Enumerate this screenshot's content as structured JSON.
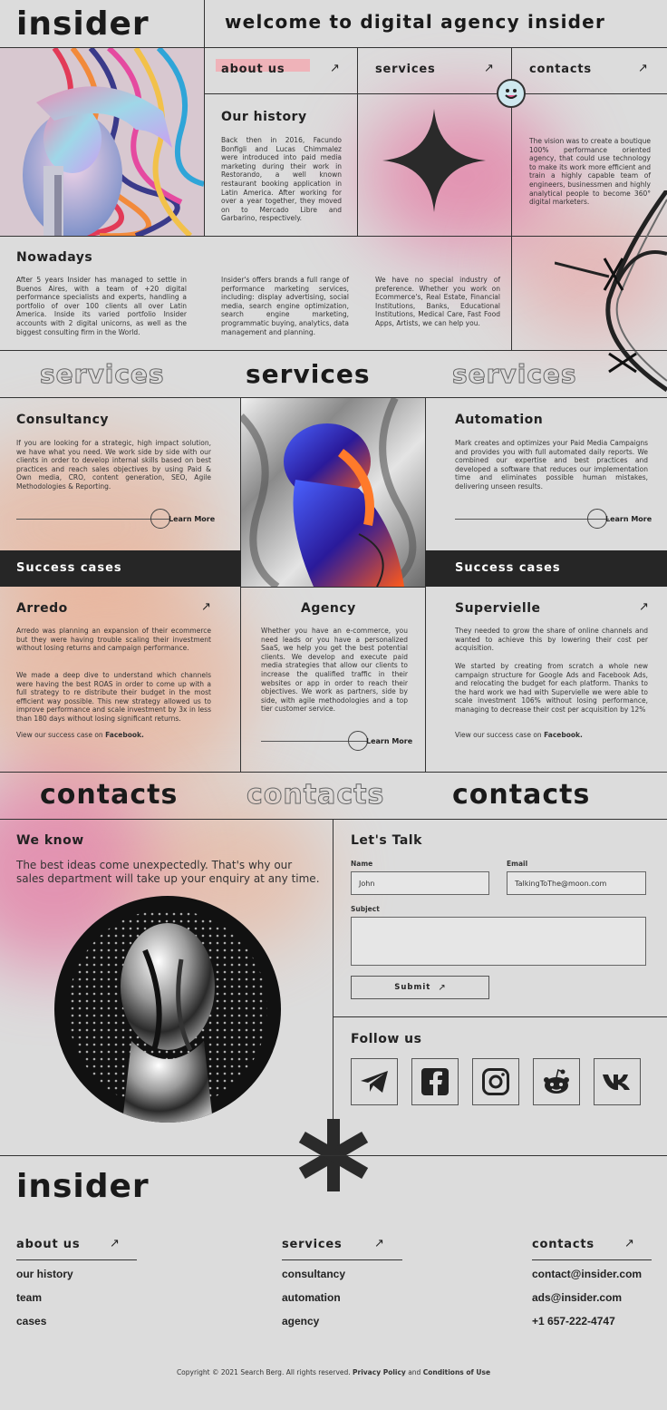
{
  "header": {
    "logo": "insider",
    "welcome": "welcome to digital agency insider"
  },
  "nav": {
    "about": "about us",
    "services": "services",
    "contacts": "contacts",
    "arrow": "↗"
  },
  "history": {
    "title": "Our history",
    "text": "Back then in 2016, Facundo Bonfigli and Lucas Chimmalez were introduced into paid media marketing during their work in Restorando, a well known restaurant booking application in Latin America. After working for over a year together, they moved on to Mercado Libre and Garbarino, respectively."
  },
  "vision": {
    "text": "The vision was to create a boutique 100% performance oriented agency, that could use technology to make its work more efficient and train a highly capable team of engineers, businessmen and highly analytical people to become 360° digital marketers."
  },
  "nowadays": {
    "title": "Nowadays",
    "col1": "After 5 years Insider has managed to settle in Buenos Aires, with a team of +20 digital performance specialists and experts, handling a portfolio of over 100 clients all over Latin America. Inside its varied portfolio Insider accounts with 2 digital unicorns, as well as the biggest consulting firm in the World.",
    "col2": "Insider's offers brands a full range of performance marketing services, including: display advertising, social media, search engine optimization, search engine marketing, programmatic buying, analytics, data management and planning.",
    "col3": "We have no special industry of preference. Whether you work on Ecommerce's, Real Estate, Financial Institutions, Banks, Educational Institutions, Medical Care, Fast Food Apps, Artists, we can help you."
  },
  "services_band": {
    "left": "services",
    "center": "services",
    "right": "services"
  },
  "consultancy": {
    "title": "Consultancy",
    "text": "If you are looking for a strategic, high impact solution, we have what you need. We work side by side with our clients in order to develop internal skills based on best practices and reach sales objectives by using Paid & Own media, CRO, content generation, SEO, Agile Methodologies & Reporting.",
    "learn": "Learn More"
  },
  "automation": {
    "title": "Automation",
    "text": "Mark creates and optimizes your Paid Media Campaigns and provides you with full automated daily reports. We combined our expertise and best practices and developed a software that reduces our implementation time and eliminates possible human mistakes, delivering unseen results.",
    "learn": "Learn More"
  },
  "success": {
    "left": "Success cases",
    "right": "Success cases"
  },
  "arredo": {
    "title": "Arredo",
    "p1": "Arredo was planning an expansion of their ecommerce but they were having trouble scaling their investment without losing returns and campaign performance.",
    "p2": "We made a deep dive to understand which channels were having the best ROAS in order to come up with a full strategy to re distribute their budget in the most efficient way possible. This new strategy allowed us to improve performance and scale investment by 3x in less than 180 days without losing significant returns.",
    "view": "View our success case on ",
    "fb": "Facebook."
  },
  "agency": {
    "title": "Agency",
    "text": "Whether you have an e-commerce, you need leads or you have a personalized SaaS, we help you get the best potential clients. We develop and execute paid media strategies that allow our clients to increase the qualified traffic in their websites or app in order to reach their objectives. We work as partners, side by side, with agile methodologies and a top tier customer service.",
    "learn": "Learn More"
  },
  "supervielle": {
    "title": "Supervielle",
    "p1": "They needed to grow the share of online channels and wanted to achieve this by lowering their cost per acquisition.",
    "p2": "We started by creating from scratch a whole new campaign structure for Google Ads and Facebook Ads, and relocating the budget for each platform. Thanks to the hard work we had with Supervielle we were able to scale investment 106% without losing performance, managing to decrease their cost per acquisition by 12%",
    "view": "View our success case on ",
    "fb": "Facebook."
  },
  "contacts_band": {
    "left": "contacts",
    "center": "contacts",
    "right": "contacts"
  },
  "weknow": {
    "title": "We know",
    "text": "The best ideas come unexpectedly. That's why our sales department will take up your enquiry at any time."
  },
  "form": {
    "title": "Let's Talk",
    "name_label": "Name",
    "name_value": "John",
    "email_label": "Email",
    "email_value": "TalkingToThe@moon.com",
    "subject_label": "Subject",
    "submit": "Submit"
  },
  "follow": {
    "title": "Follow us",
    "icons": [
      "telegram-icon",
      "facebook-icon",
      "instagram-icon",
      "reddit-icon",
      "vk-icon"
    ]
  },
  "footer": {
    "logo": "insider",
    "about": "about us",
    "services": "services",
    "contacts": "contacts",
    "about_items": [
      "our history",
      "team",
      "cases"
    ],
    "service_items": [
      "consultancy",
      "automation",
      "agency"
    ],
    "contact_items": [
      "contact@insider.com",
      "ads@insider.com",
      "+1 657-222-4747"
    ],
    "copyright": "Copyright © 2021 Search Berg. All rights reserved. ",
    "privacy": "Privacy Policy",
    "and": " and ",
    "conditions": "Conditions of Use"
  },
  "colors": {
    "background": "#dcdcdc",
    "ink": "#222222",
    "pink": "#e06a8c",
    "orange": "#f0a070",
    "highlight": "#f4a9b0"
  }
}
